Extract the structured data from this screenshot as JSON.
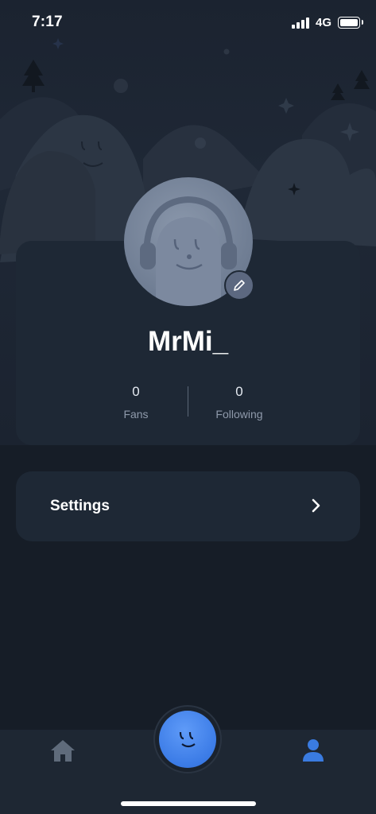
{
  "status_bar": {
    "time": "7:17",
    "network": "4G"
  },
  "profile": {
    "username": "MrMi_",
    "stats": [
      {
        "value": "0",
        "label": "Fans"
      },
      {
        "value": "0",
        "label": "Following"
      }
    ]
  },
  "menu": {
    "settings_label": "Settings"
  },
  "tab_bar": {
    "active_tab": "profile",
    "active_color": "#3a7be0",
    "inactive_color": "#5f6b7b"
  },
  "colors": {
    "background": "#161d27",
    "card": "#1e2835",
    "accent": "#3b7be6"
  }
}
